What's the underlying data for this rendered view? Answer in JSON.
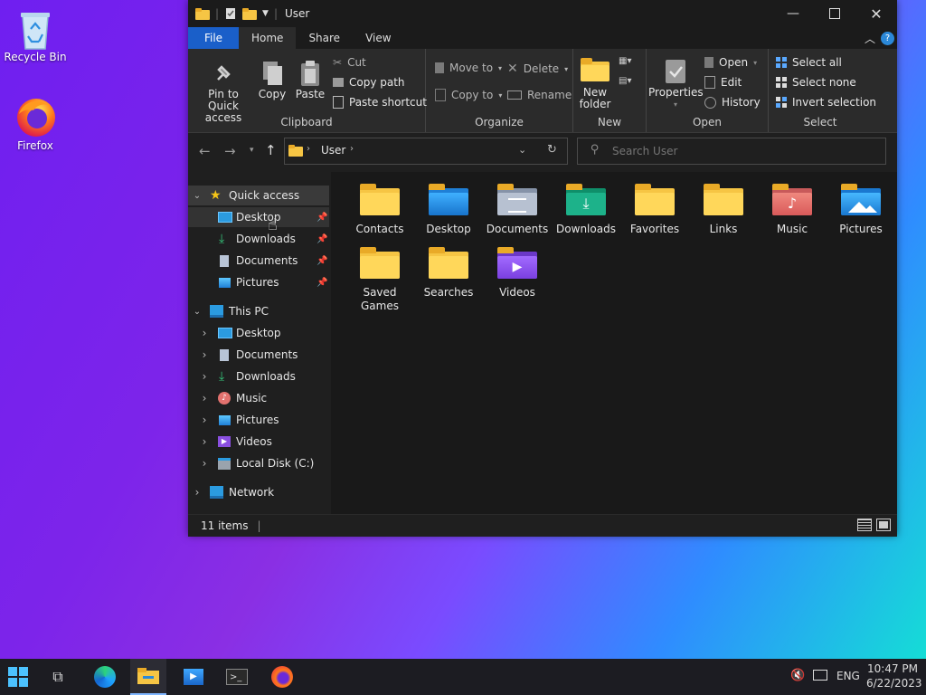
{
  "desktop": {
    "icons": [
      {
        "label": "Recycle Bin"
      },
      {
        "label": "Firefox"
      }
    ]
  },
  "window": {
    "title": "User",
    "tabs": [
      "File",
      "Home",
      "Share",
      "View"
    ],
    "ribbon": {
      "clipboard": {
        "label": "Clipboard",
        "pin": "Pin to Quick access",
        "copy": "Copy",
        "paste": "Paste",
        "cut": "Cut",
        "copy_path": "Copy path",
        "paste_shortcut": "Paste shortcut"
      },
      "organize": {
        "label": "Organize",
        "move_to": "Move to",
        "copy_to": "Copy to",
        "delete": "Delete",
        "rename": "Rename"
      },
      "new": {
        "label": "New",
        "new_folder": "New folder"
      },
      "open": {
        "label": "Open",
        "properties": "Properties",
        "open": "Open",
        "edit": "Edit",
        "history": "History"
      },
      "select": {
        "label": "Select",
        "select_all": "Select all",
        "select_none": "Select none",
        "invert": "Invert selection"
      }
    },
    "address": {
      "path": "User",
      "search_placeholder": "Search User"
    },
    "nav": {
      "quick_access": "Quick access",
      "quick_items": [
        "Desktop",
        "Downloads",
        "Documents",
        "Pictures"
      ],
      "this_pc": "This PC",
      "pc_items": [
        "Desktop",
        "Documents",
        "Downloads",
        "Music",
        "Pictures",
        "Videos",
        "Local Disk (C:)"
      ],
      "network": "Network"
    },
    "files": [
      {
        "name": "Contacts",
        "icon": "folder"
      },
      {
        "name": "Desktop",
        "icon": "desktop-folder"
      },
      {
        "name": "Documents",
        "icon": "documents-folder"
      },
      {
        "name": "Downloads",
        "icon": "downloads-folder"
      },
      {
        "name": "Favorites",
        "icon": "folder"
      },
      {
        "name": "Links",
        "icon": "folder"
      },
      {
        "name": "Music",
        "icon": "music-folder"
      },
      {
        "name": "Pictures",
        "icon": "pictures-folder"
      },
      {
        "name": "Saved Games",
        "icon": "folder"
      },
      {
        "name": "Searches",
        "icon": "folder"
      },
      {
        "name": "Videos",
        "icon": "videos-folder"
      }
    ],
    "status": {
      "count": "11 items"
    }
  },
  "taskbar": {
    "lang": "ENG",
    "time": "10:47 PM",
    "date": "6/22/2023"
  },
  "colors": {
    "file_tab": "#1a5fc9",
    "folder": "#ffd75a",
    "accent": "#2b88d8"
  }
}
